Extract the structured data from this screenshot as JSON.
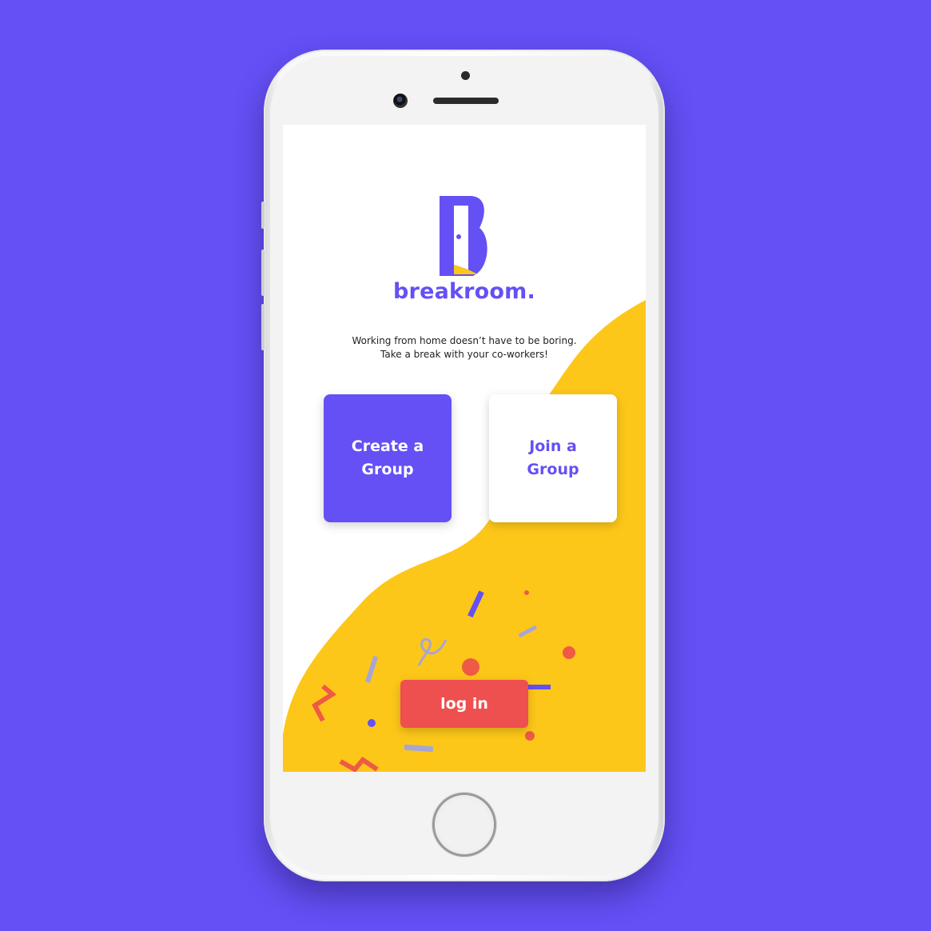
{
  "app": {
    "brand": "breakroom."
  },
  "tagline": {
    "line1": "Working from home doesn’t have to be boring.",
    "line2": "Take a break with your co-workers!"
  },
  "cards": {
    "create_label": "Create a Group",
    "join_label": "Join a Group"
  },
  "actions": {
    "login_label": "log in"
  },
  "icons": {
    "logo": "door-b-logo-icon"
  },
  "colors": {
    "page_background": "#6450f5",
    "accent": "#6450f5",
    "wave": "#fdc719",
    "login_button": "#ee4f4f"
  }
}
